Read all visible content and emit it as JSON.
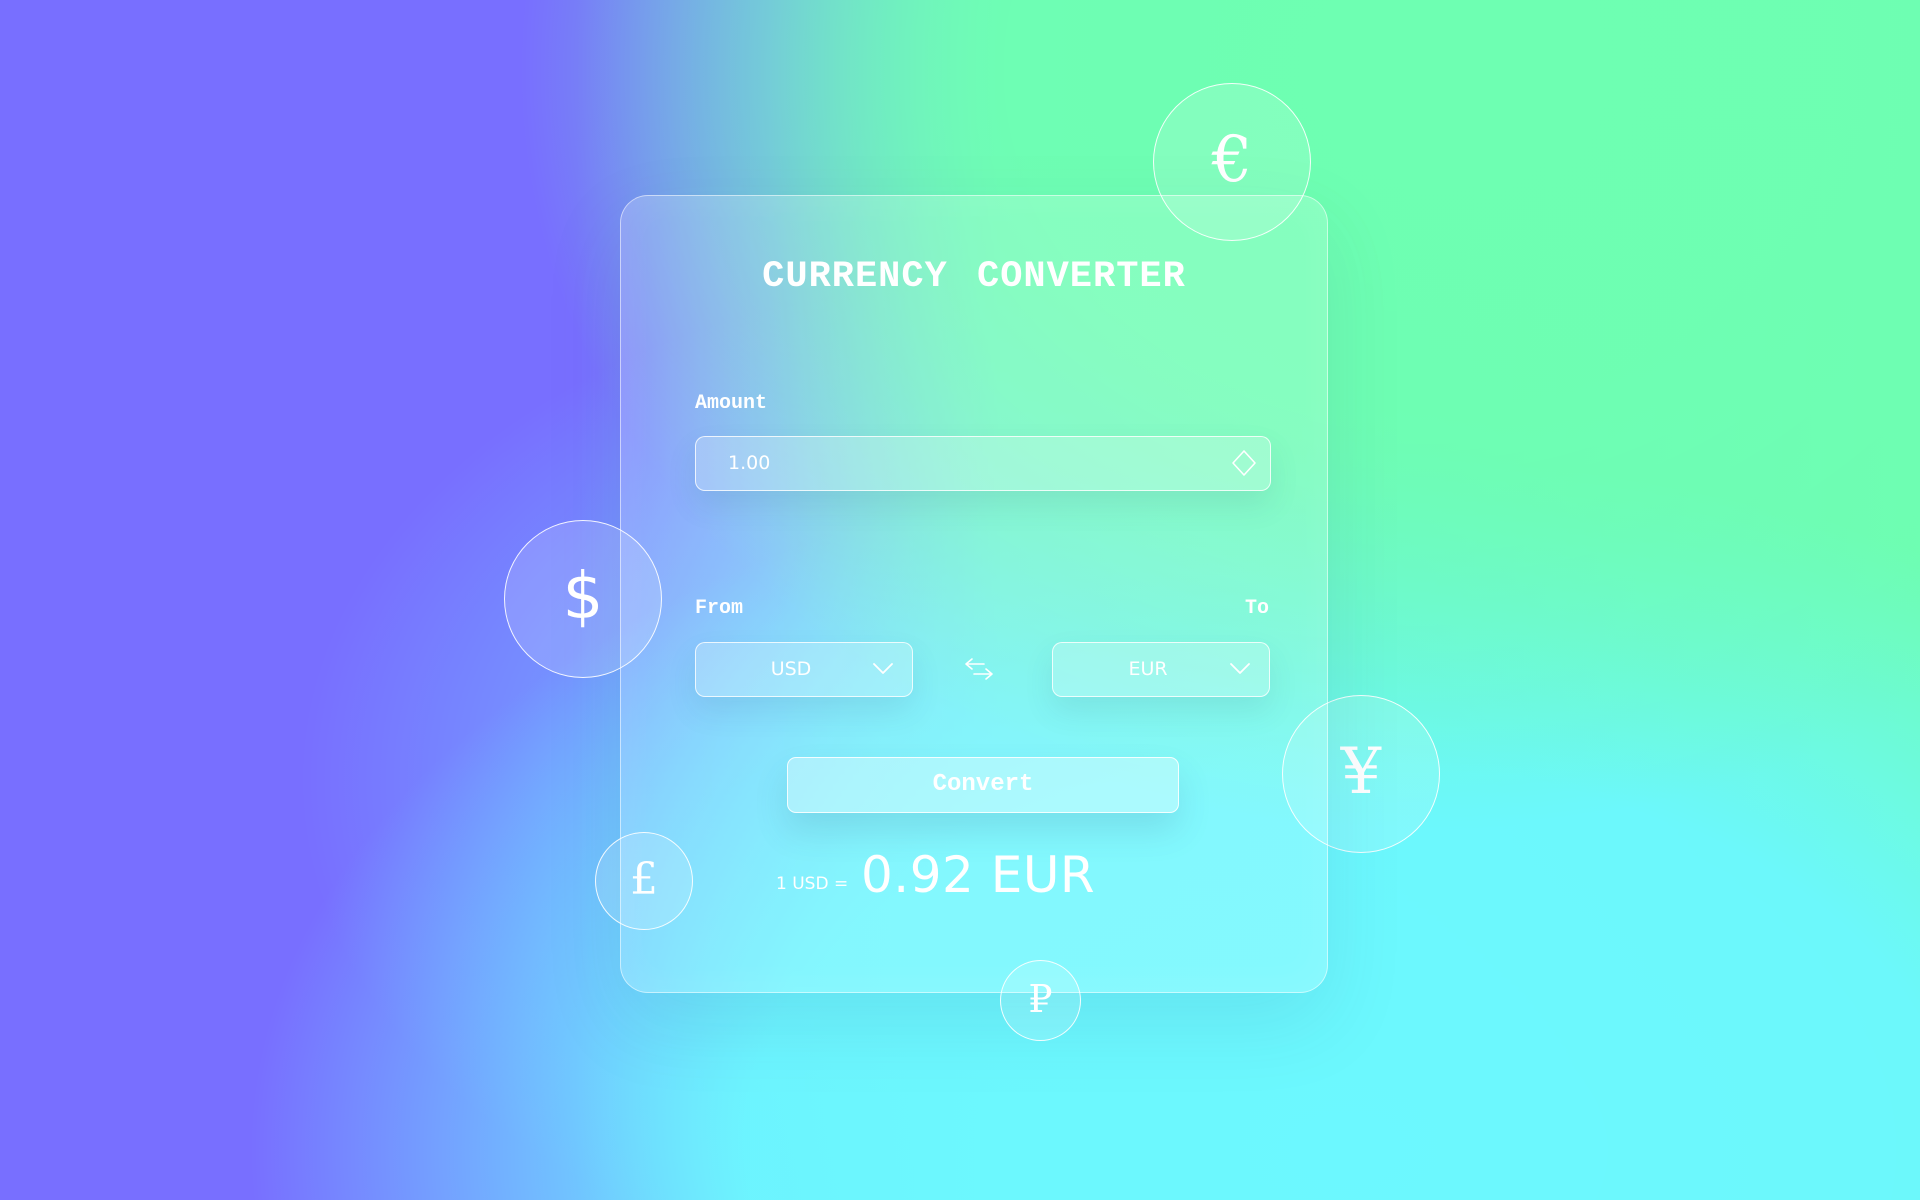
{
  "converter": {
    "title": "CURRENCY CONVERTER",
    "amount_label": "Amount",
    "amount_value": "1.00",
    "from_label": "From",
    "to_label": "To",
    "from_currency": "USD",
    "to_currency": "EUR",
    "convert_label": "Convert",
    "rate_prefix": "1 USD =",
    "rate_result": "0.92 EUR"
  },
  "coins": {
    "euro": "€",
    "dollar": "$",
    "yen": "¥",
    "pound": "£",
    "ruble": "₽"
  },
  "icons": {
    "stepper": "up-down-stepper-icon",
    "chevron": "chevron-down-icon",
    "swap": "swap-arrows-icon"
  },
  "colors": {
    "background_left": "#786fff",
    "background_top_right": "#6efdb2",
    "background_bottom_right": "#6cf8ff",
    "text": "#ffffff"
  }
}
